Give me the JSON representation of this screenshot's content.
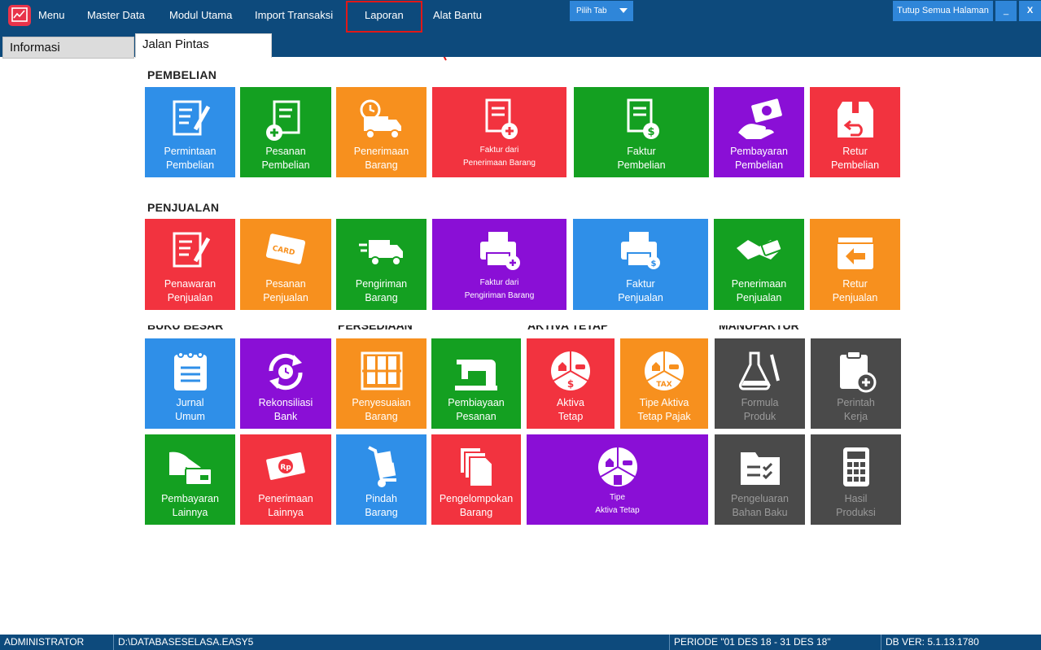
{
  "menubar": {
    "menu_label": "Menu",
    "items": [
      "Master Data",
      "Modul Utama",
      "Import Transaksi",
      "Laporan",
      "Alat Bantu"
    ],
    "pilih_tab": "Pilih Tab",
    "close_all": "Tutup Semua Halaman",
    "minimize": "_",
    "close": "X"
  },
  "tabs": {
    "info": "Informasi",
    "shortcuts": "Jalan Pintas"
  },
  "sections": {
    "pembelian": "PEMBELIAN",
    "penjualan": "PENJUALAN",
    "clipped": [
      "BUKU BESAR",
      "PERSEDIAAN",
      "AKTIVA TETAP",
      "MANUFAKTUR"
    ]
  },
  "tiles": {
    "permintaan_pembelian": [
      "Permintaan",
      "Pembelian"
    ],
    "pesanan_pembelian": [
      "Pesanan",
      "Pembelian"
    ],
    "penerimaan_barang": [
      "Penerimaan",
      "Barang"
    ],
    "faktur_dari_penerimaan": [
      "Faktur dari",
      "Penerimaan Barang"
    ],
    "faktur_pembelian": [
      "Faktur",
      "Pembelian"
    ],
    "pembayaran_pembelian": [
      "Pembayaran",
      "Pembelian"
    ],
    "retur_pembelian": [
      "Retur",
      "Pembelian"
    ],
    "penawaran_penjualan": [
      "Penawaran",
      "Penjualan"
    ],
    "pesanan_penjualan": [
      "Pesanan",
      "Penjualan"
    ],
    "pengiriman_barang": [
      "Pengiriman",
      "Barang"
    ],
    "faktur_dari_pengiriman": [
      "Faktur dari",
      "Pengiriman Barang"
    ],
    "faktur_penjualan": [
      "Faktur",
      "Penjualan"
    ],
    "penerimaan_penjualan": [
      "Penerimaan",
      "Penjualan"
    ],
    "retur_penjualan": [
      "Retur",
      "Penjualan"
    ],
    "jurnal_umum": [
      "Jurnal",
      "Umum"
    ],
    "rekonsiliasi_bank": [
      "Rekonsiliasi",
      "Bank"
    ],
    "penyesuaian_barang": [
      "Penyesuaian",
      "Barang"
    ],
    "pembiayaan_pesanan": [
      "Pembiayaan",
      "Pesanan"
    ],
    "aktiva_tetap": [
      "Aktiva",
      "Tetap"
    ],
    "tipe_aktiva_pajak": [
      "Tipe Aktiva",
      "Tetap Pajak"
    ],
    "formula_produk": [
      "Formula",
      "Produk"
    ],
    "perintah_kerja": [
      "Perintah",
      "Kerja"
    ],
    "pembayaran_lainnya": [
      "Pembayaran",
      "Lainnya"
    ],
    "penerimaan_lainnya": [
      "Penerimaan",
      "Lainnya"
    ],
    "pindah_barang": [
      "Pindah",
      "Barang"
    ],
    "pengelompokan_barang": [
      "Pengelompokan",
      "Barang"
    ],
    "tipe_aktiva_tetap": [
      "Tipe",
      "Aktiva Tetap"
    ],
    "pengeluaran_bahan_baku": [
      "Pengeluaran",
      "Bahan Baku"
    ],
    "hasil_produksi": [
      "Hasil",
      "Produksi"
    ]
  },
  "icon_text": {
    "card": "CARD",
    "rp": "Rp",
    "tax": "TAX"
  },
  "statusbar": {
    "user": "ADMINISTRATOR",
    "database": "D:\\DATABASESELASA.EASY5",
    "periode": "PERIODE \"01 DES 18 - 31 DES 18\"",
    "db_ver": "DB VER: 5.1.13.1780"
  },
  "colors": {
    "chrome": "#0d4a7c",
    "accent_button": "#2f86d9",
    "highlight_box": "#e01818",
    "tile_blue": "#2f8fe8",
    "tile_green": "#14a021",
    "tile_orange": "#f7901e",
    "tile_red": "#f2333f",
    "tile_purple": "#8a0fd6",
    "tile_gray": "#4a4a4a"
  }
}
